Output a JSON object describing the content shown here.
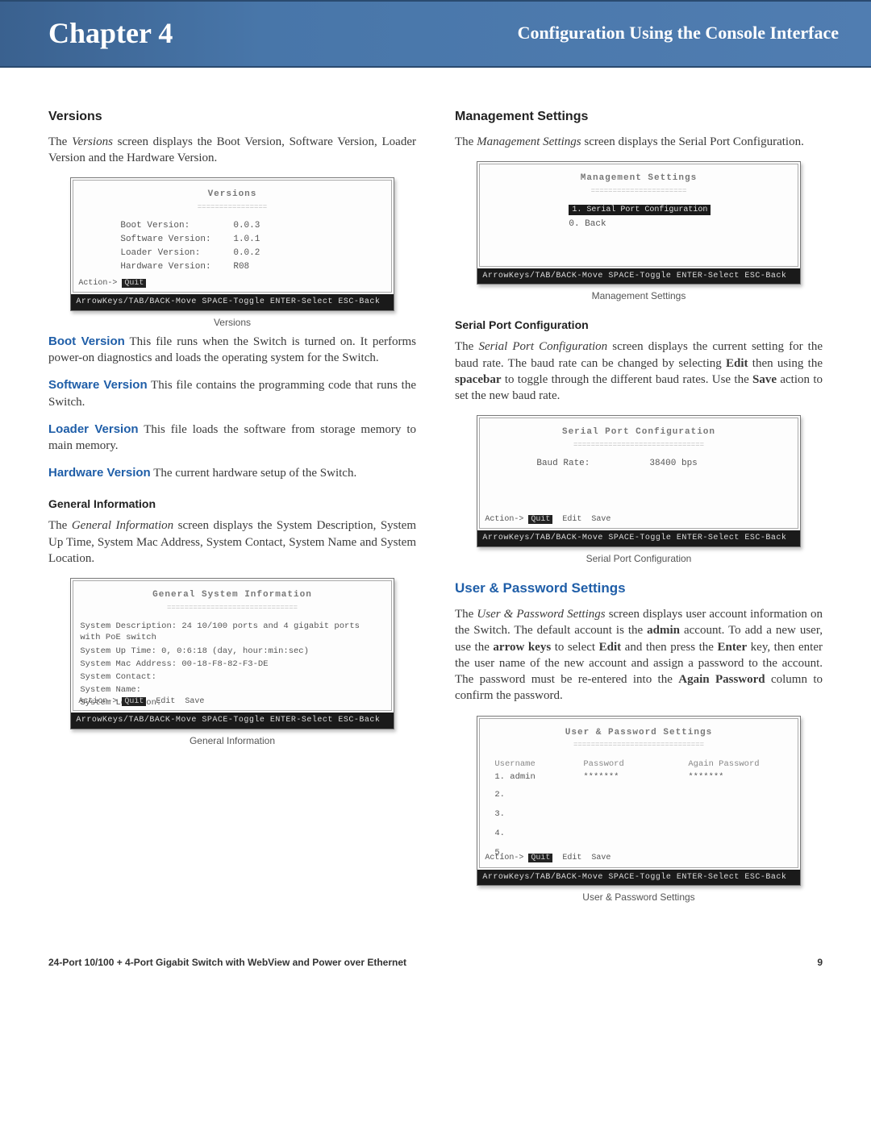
{
  "header": {
    "chapter": "Chapter 4",
    "title": "Configuration Using the Console Interface"
  },
  "left": {
    "versions": {
      "heading": "Versions",
      "intro_pre": "The ",
      "intro_em": "Versions",
      "intro_post": " screen displays the Boot Version, Software Version, Loader Version and the Hardware Version.",
      "fig": {
        "title": "Versions",
        "rows": [
          {
            "label": "Boot Version:",
            "value": "0.0.3"
          },
          {
            "label": "Software Version:",
            "value": "1.0.1"
          },
          {
            "label": "Loader Version:",
            "value": "0.0.2"
          },
          {
            "label": "Hardware Version:",
            "value": "R08"
          }
        ],
        "actions": "Action-> Quit",
        "footer": "ArrowKeys/TAB/BACK-Move  SPACE-Toggle  ENTER-Select  ESC-Back",
        "caption": "Versions"
      },
      "boot_term": "Boot Version",
      "boot_desc": "  This file runs when the Switch is turned on. It performs power-on diagnostics and loads the operating system for the Switch.",
      "soft_term": "Software Version",
      "soft_desc": " This file contains the programming code that runs the Switch.",
      "load_term": "Loader Version",
      "load_desc": "  This file loads the software from storage memory to main memory.",
      "hard_term": "Hardware Version",
      "hard_desc": " The current hardware setup of the Switch."
    },
    "general": {
      "heading": "General Information",
      "intro_pre": "The ",
      "intro_em": "General Information",
      "intro_post": " screen displays the System Description, System Up Time, System Mac Address, System Contact, System Name and System Location.",
      "fig": {
        "title": "General System Information",
        "rows": [
          "System Description: 24 10/100 ports and 4 gigabit ports with PoE switch",
          "System Up Time:    0, 0:6:18  (day, hour:min:sec)",
          "System Mac Address: 00-18-F8-82-F3-DE",
          "System Contact:",
          "System Name:",
          "System Location:"
        ],
        "actions": "Action-> Quit  Edit  Save",
        "footer": "ArrowKeys/TAB/BACK-Move  SPACE-Toggle  ENTER-Select  ESC-Back",
        "caption": "General Information"
      }
    }
  },
  "right": {
    "mgmt": {
      "heading": "Management Settings",
      "intro_pre": "The ",
      "intro_em": "Management Settings",
      "intro_post": " screen displays the Serial Port Configuration.",
      "fig": {
        "title": "Management Settings",
        "opt1": "1. Serial Port Configuration",
        "opt0": "0. Back",
        "footer": "ArrowKeys/TAB/BACK-Move  SPACE-Toggle  ENTER-Select  ESC-Back",
        "caption": "Management Settings"
      }
    },
    "serial": {
      "heading": "Serial Port Configuration",
      "p_pre": "The ",
      "p_em": "Serial Port Configuration",
      "p_mid1": " screen displays the current setting for the baud rate. The baud rate can be changed by selecting ",
      "p_b1": "Edit",
      "p_mid2": " then using the ",
      "p_b2": "spacebar",
      "p_mid3": " to toggle through the different baud rates. Use the ",
      "p_b3": "Save",
      "p_post": " action to set the new baud rate.",
      "fig": {
        "title": "Serial Port Configuration",
        "label": "Baud Rate:",
        "value": "38400   bps",
        "actions": "Action-> Quit  Edit  Save",
        "footer": "ArrowKeys/TAB/BACK-Move  SPACE-Toggle  ENTER-Select  ESC-Back",
        "caption": "Serial Port Configuration"
      }
    },
    "userpw": {
      "heading": "User & Password Settings",
      "p_pre": "The ",
      "p_em": "User & Password Settings",
      "p_mid1": " screen displays user account information on the Switch. The default account is the ",
      "p_b1": "admin",
      "p_mid2": " account. To add a new user, use the ",
      "p_b2": "arrow keys",
      "p_mid3": " to select ",
      "p_b3": "Edit",
      "p_mid4": " and then press the ",
      "p_b4": "Enter",
      "p_mid5": " key, then enter the user name of the new account and assign a password to the account. The password must be re-entered into the ",
      "p_b5": "Again Password",
      "p_post": " column to confirm the password.",
      "fig": {
        "title": "User & Password Settings",
        "head1": "Username",
        "head2": "Password",
        "head3": "Again Password",
        "row1_user": "1. admin",
        "row1_pw": "*******",
        "row1_pw2": "*******",
        "n2": "2.",
        "n3": "3.",
        "n4": "4.",
        "n5": "5.",
        "actions": "Action-> Quit  Edit  Save",
        "footer": "ArrowKeys/TAB/BACK-Move  SPACE-Toggle  ENTER-Select  ESC-Back",
        "caption": "User & Password Settings"
      }
    }
  },
  "footer": {
    "product": "24-Port 10/100 + 4-Port Gigabit Switch with WebView and Power over Ethernet",
    "page": "9"
  }
}
